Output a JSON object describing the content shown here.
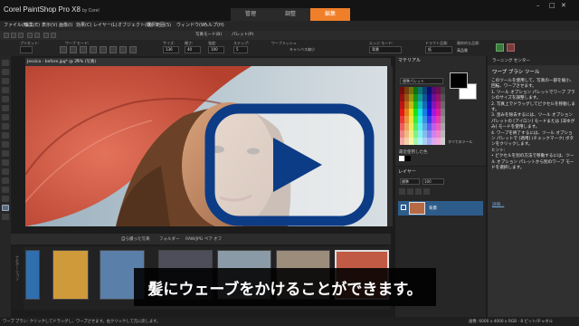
{
  "app": {
    "title": "Corel PaintShop Pro X8",
    "brand": "by Corel"
  },
  "workspace_tabs": [
    {
      "label": "管理"
    },
    {
      "label": "調整"
    },
    {
      "label": "編集",
      "active": true
    }
  ],
  "menu": [
    "ファイル(F)",
    "編集(E)",
    "表示(V)",
    "画像(I)",
    "効果(C)",
    "レイヤー(L)",
    "オブジェクト(O)",
    "選択範囲(S)",
    "ウィンドウ(W)",
    "ヘルプ(H)"
  ],
  "tool_options": {
    "preset_label": "プリセット:",
    "mode_label": "ワープ モード:",
    "size_label": "サイズ:",
    "size_value": "136",
    "hardness_label": "硬さ:",
    "hardness_value": "40",
    "strength_label": "強度:",
    "strength_value": "100",
    "step_label": "ステップ:",
    "step_value": "5",
    "warp_mesh_label": "ワープメッシュ",
    "edge_mode_label": "エッジ モード:",
    "edge_mode_value": "背景",
    "draft_quality_label": "ドラフト品質:",
    "draft_quality_value": "低",
    "final_quality_label": "最終的な品質:",
    "final_quality_value": "高品質",
    "photo_mode": "写真モード(B)",
    "palette_on": "パレット(P)",
    "canvas_pos": "キャンバス縮小",
    "warp_show_label": "ワープ メッシュを表示"
  },
  "image_window": {
    "tab_label": "Jessica - before.jpg* @ 25% (写真)",
    "close": "×"
  },
  "organizer": {
    "collection": "自ら撮った写真",
    "folder": "フォルダー",
    "raw_filter": "RAW/JPG ペア オフ",
    "side_label": "ナビゲーション"
  },
  "materials": {
    "title": "マテリアル",
    "dropdown": "標準パレット",
    "all_tools": "すべてのツール",
    "recent": "最近使用した色"
  },
  "layers": {
    "title": "レイヤー",
    "blend": "標準",
    "opacity": "100",
    "layer_name": "背景"
  },
  "learning": {
    "header": "ラーニング センター",
    "title": "ワープ ブラシ ツール",
    "body": "このツールを使用して、写真の一部を縮小、回転、ワープさせます。\n1. ツール オプション パレットでワープ ブラシのサイズを調整します。\n2. 写真上でドラッグしてピクセルを移動します。\n3. 歪みを除去するには、ツール オプション パレットの [アイロン] モードまたは [非ゆがみ] モードを使用します。\n4. ワープを終了するには、ツール オプション パレットで [適用] (チェックマーク) ボタンをクリックします。\nヒント:\n• ピクセルを別の方法で移動するには、ツール オプション パレットから別のワープ モードを選択します。",
    "details": "詳細..."
  },
  "status": {
    "left": "ワープ ブラシ: クリックしてドラッグし、ワープさせます。右クリックして元に戻します。",
    "right": "画像: 6000 x 4000 x RGB - 8 ビット/チャネル"
  },
  "subtitle": "髪にウェーブをかけることができます。",
  "colors": {
    "accent": "#f07f2a",
    "play_blue": "#0d3c86"
  }
}
